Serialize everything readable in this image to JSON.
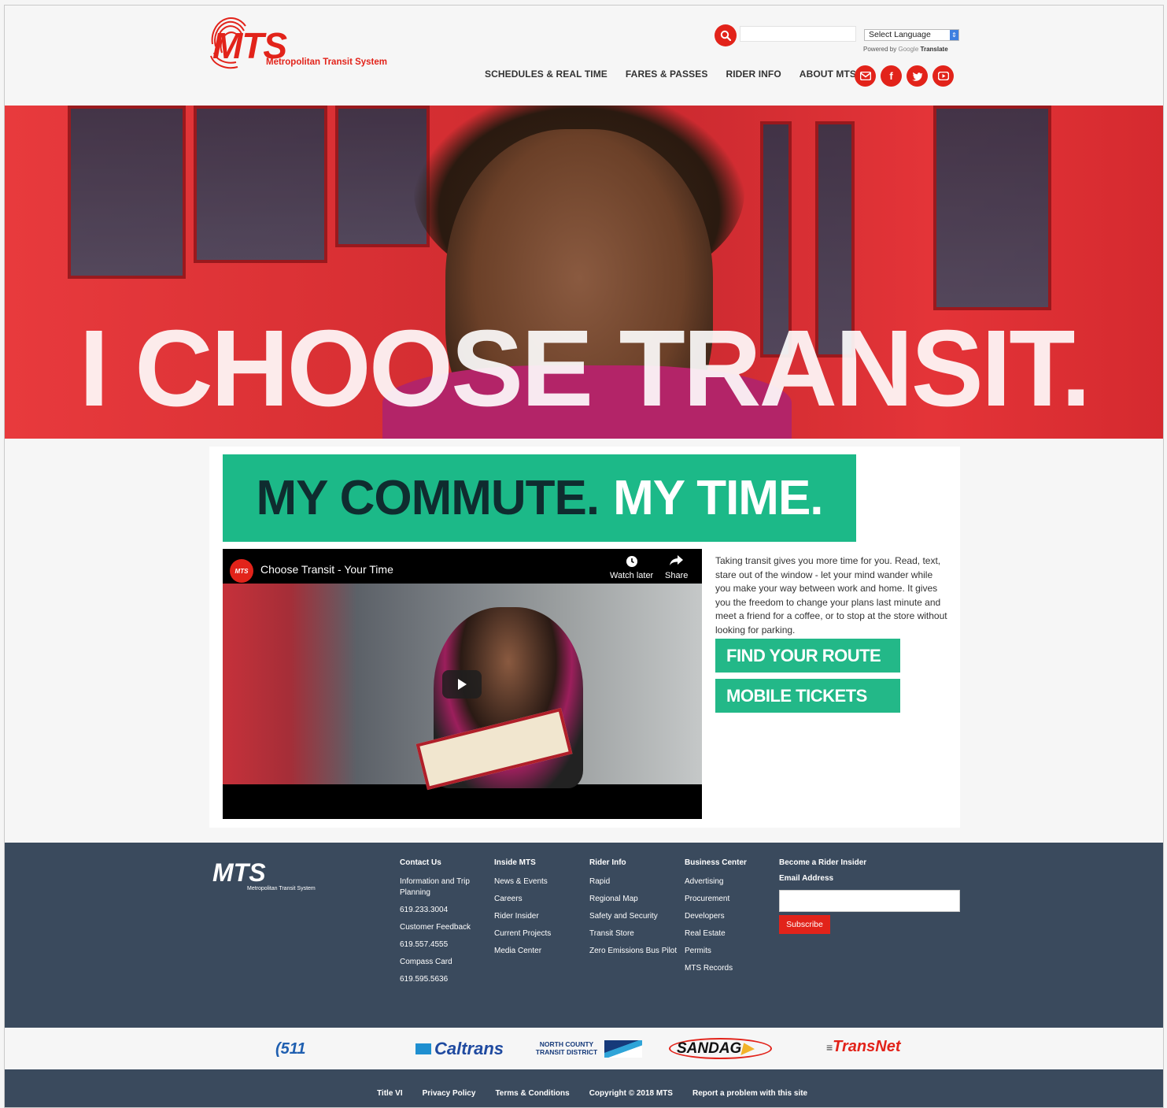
{
  "header": {
    "logo_text": "MTS",
    "logo_subtitle": "Metropolitan Transit System",
    "search_placeholder": "",
    "language_select": "Select Language",
    "powered_by": "Powered by",
    "google": "Google",
    "translate": "Translate",
    "nav": [
      {
        "label": "SCHEDULES & REAL TIME"
      },
      {
        "label": "FARES & PASSES"
      },
      {
        "label": "RIDER INFO"
      },
      {
        "label": "ABOUT MTS"
      }
    ],
    "social_icons": [
      "email-icon",
      "facebook-icon",
      "twitter-icon",
      "youtube-icon"
    ]
  },
  "hero": {
    "tagline": "I CHOOSE TRANSIT."
  },
  "main": {
    "banner_dark": "MY COMMUTE.",
    "banner_light": "MY TIME.",
    "video": {
      "channel_logo": "MTS",
      "title": "Choose Transit - Your Time",
      "watch_later": "Watch later",
      "share": "Share"
    },
    "intro_text": "Taking transit gives you more time for you. Read, text, stare out of the window - let your mind wander while you make your way between work and home. It gives you the freedom to change your plans last minute and meet a friend for a coffee, or to stop at the store without looking for parking.",
    "cta_find_route": "FIND YOUR ROUTE",
    "cta_mobile_tickets": "MOBILE TICKETS"
  },
  "footer": {
    "logo_text": "MTS",
    "logo_subtitle": "Metropolitan Transit System",
    "contact": {
      "heading": "Contact Us",
      "items": [
        "Information and Trip Planning",
        "619.233.3004",
        "Customer Feedback",
        "619.557.4555",
        "Compass Card",
        "619.595.5636"
      ]
    },
    "inside": {
      "heading": "Inside MTS",
      "items": [
        "News & Events",
        "Careers",
        "Rider Insider",
        "Current Projects",
        "Media Center"
      ]
    },
    "rider": {
      "heading": "Rider Info",
      "items": [
        "Rapid",
        "Regional Map",
        "Safety and Security",
        "Transit Store",
        "Zero Emissions Bus Pilot"
      ]
    },
    "business": {
      "heading": "Business Center",
      "items": [
        "Advertising",
        "Procurement",
        "Developers",
        "Real Estate",
        "Permits",
        "MTS Records"
      ]
    },
    "newsletter": {
      "heading": "Become a Rider Insider",
      "email_label": "Email Address",
      "subscribe": "Subscribe"
    }
  },
  "partners": [
    "511",
    "Caltrans",
    "NORTH COUNTY TRANSIT DISTRICT",
    "SANDAG",
    "TransNet"
  ],
  "bottom_links": [
    "Title VI",
    "Privacy Policy",
    "Terms & Conditions",
    "Copyright © 2018 MTS",
    "Report a problem with this site"
  ],
  "colors": {
    "brand_red": "#e2231a",
    "green": "#1cb988",
    "footer_bg": "#3a4a5d"
  }
}
